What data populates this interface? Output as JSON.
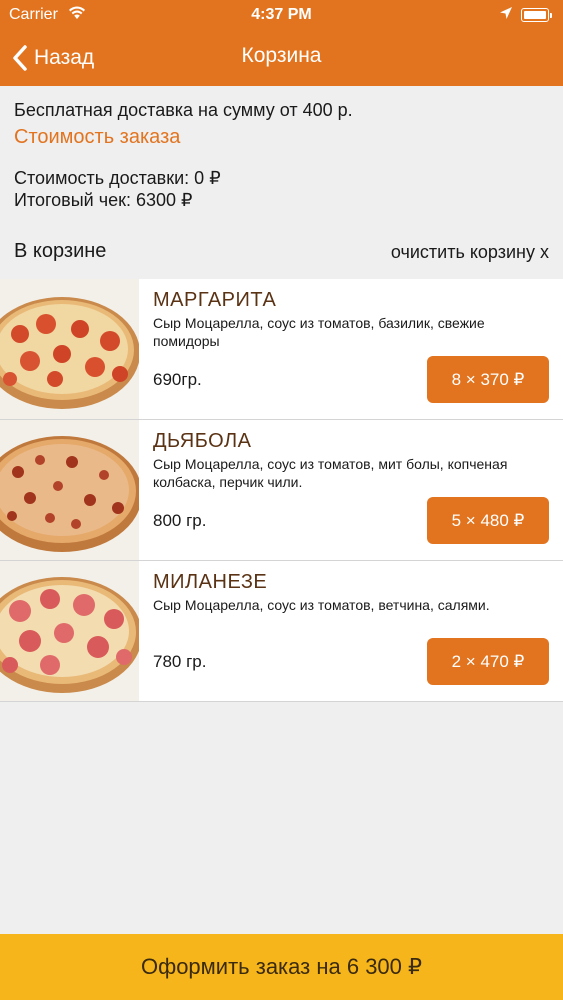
{
  "status_bar": {
    "carrier": "Carrier",
    "time": "4:37 PM"
  },
  "nav": {
    "back_label": "Назад",
    "title": "Корзина"
  },
  "info": {
    "free_delivery": "Бесплатная доставка на сумму от 400 р.",
    "order_cost_link": "Стоимость заказа",
    "delivery_cost": "Стоимость доставки: 0 ₽",
    "total": "Итоговый чек: 6300 ₽"
  },
  "cart": {
    "heading": "В корзине",
    "clear_label": "очистить корзину x",
    "items": [
      {
        "name": "МАРГАРИТА",
        "description": "Сыр Моцарелла, соус из томатов, базилик, свежие помидоры",
        "weight": "690гр.",
        "price_button": "8 × 370 ₽"
      },
      {
        "name": "ДЬЯБОЛА",
        "description": "Сыр Моцарелла, соус из томатов, мит болы, копченая колбаска, перчик чили.",
        "weight": "800 гр.",
        "price_button": "5 × 480 ₽"
      },
      {
        "name": "МИЛАНЕЗЕ",
        "description": "Сыр Моцарелла, соус из томатов, ветчина, салями.",
        "weight": "780 гр.",
        "price_button": "2 × 470 ₽"
      }
    ]
  },
  "checkout_button": "Оформить заказ на 6 300 ₽",
  "colors": {
    "accent": "#e2741f",
    "checkout": "#f6b51a",
    "background": "#efeff0",
    "item_title": "#5a3214"
  },
  "icons": {
    "back": "chevron-left-icon",
    "wifi": "wifi-icon",
    "location": "location-arrow-icon",
    "battery": "battery-icon"
  }
}
